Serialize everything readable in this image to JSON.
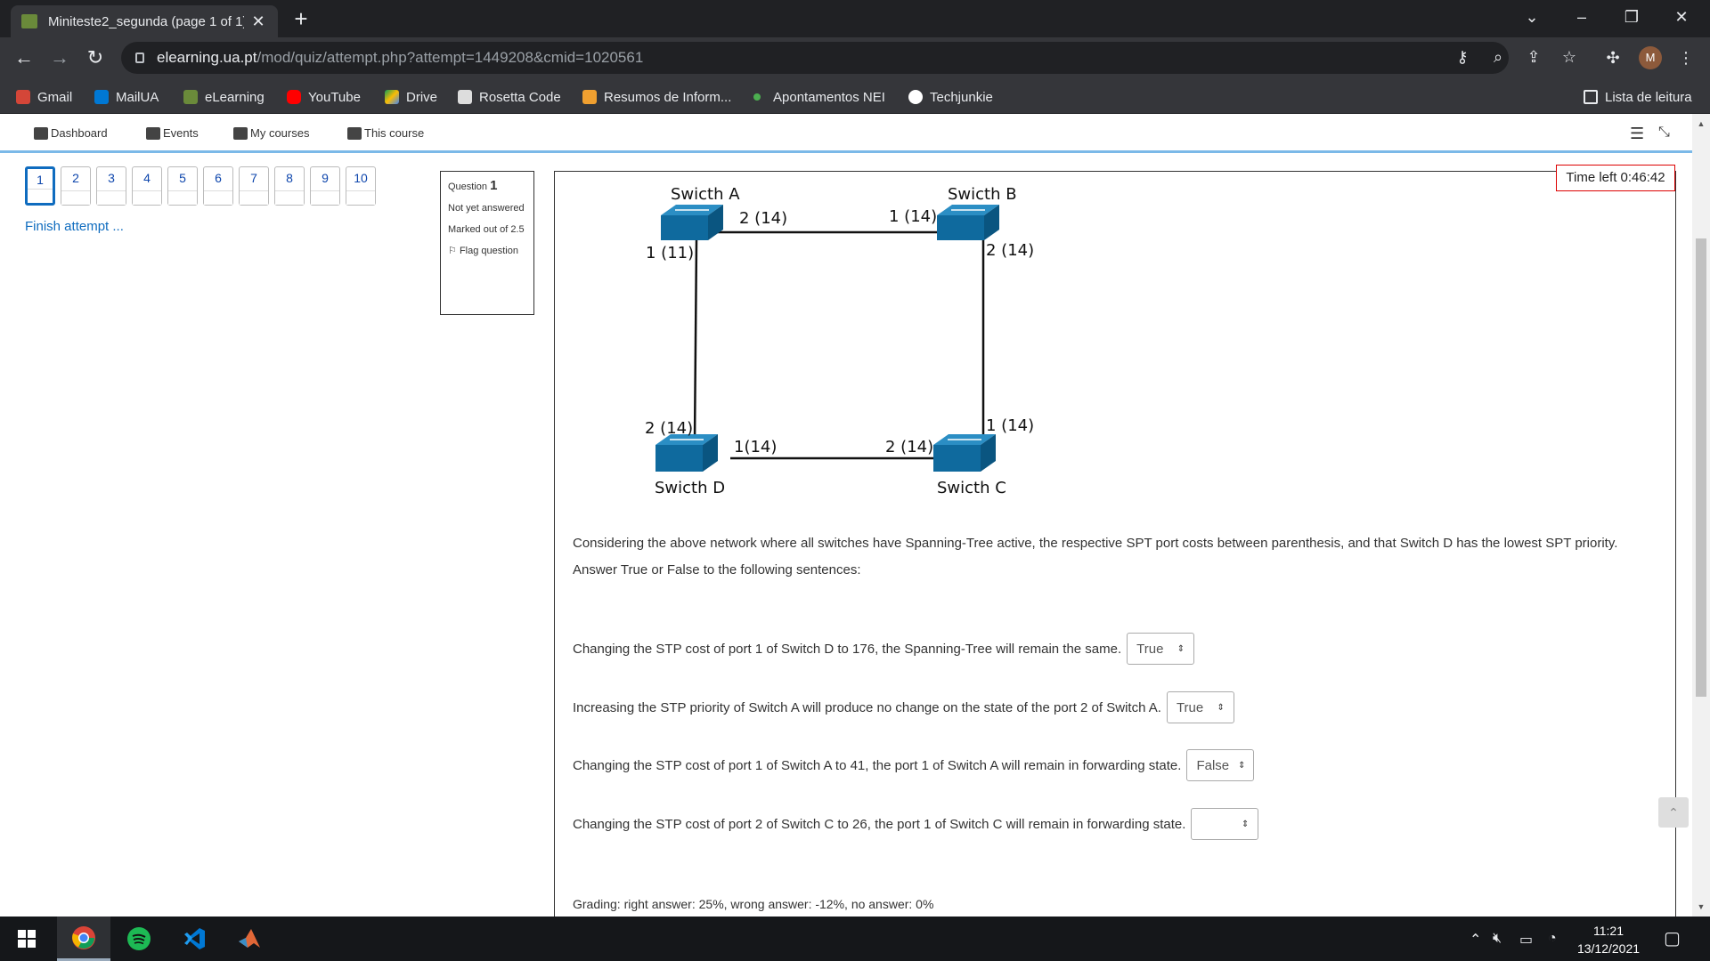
{
  "browser": {
    "tab_title": "Miniteste2_segunda (page 1 of 1)",
    "url_host": "elearning.ua.pt",
    "url_path": "/mod/quiz/attempt.php?attempt=1449208&cmid=1020561",
    "profile_initial": "M"
  },
  "bookmarks": [
    {
      "label": "Gmail",
      "icon": "gmail-icon"
    },
    {
      "label": "MailUA",
      "icon": "outlook-icon"
    },
    {
      "label": "eLearning",
      "icon": "elearning-icon"
    },
    {
      "label": "YouTube",
      "icon": "youtube-icon"
    },
    {
      "label": "Drive",
      "icon": "drive-icon"
    },
    {
      "label": "Rosetta Code",
      "icon": "rosetta-icon"
    },
    {
      "label": "Resumos de Inform...",
      "icon": "box-icon"
    },
    {
      "label": "Apontamentos NEI",
      "icon": "dot-icon"
    },
    {
      "label": "Techjunkie",
      "icon": "globe-icon"
    },
    {
      "label": "Lista de leitura",
      "icon": "reading-list-icon"
    }
  ],
  "moodle_nav": [
    {
      "label": "Dashboard",
      "icon": "dashboard-icon"
    },
    {
      "label": "Events",
      "icon": "calendar-icon"
    },
    {
      "label": "My courses",
      "icon": "briefcase-icon"
    },
    {
      "label": "This course",
      "icon": "sitemap-icon"
    }
  ],
  "quiz_nav": {
    "questions": [
      "1",
      "2",
      "3",
      "4",
      "5",
      "6",
      "7",
      "8",
      "9",
      "10"
    ],
    "current": "1",
    "finish_label": "Finish attempt ..."
  },
  "question_info": {
    "label": "Question",
    "number": "1",
    "status": "Not yet answered",
    "marks": "Marked out of 2.5",
    "flag": "Flag question"
  },
  "timer": "Time left 0:46:42",
  "diagram": {
    "switches": [
      "Swicth A",
      "Swicth B",
      "Swicth D",
      "Swicth C"
    ],
    "port_labels": {
      "a_right": "2 (14)",
      "a_down": "1 (11)",
      "b_left": "1 (14)",
      "b_down": "2 (14)",
      "d_up": "2 (14)",
      "d_right": "1(14)",
      "c_left": "2 (14)",
      "c_up": "1 (14)"
    }
  },
  "question_text": "Considering the above network where all switches have Spanning-Tree active, the respective SPT port costs between parenthesis, and that Switch D has the lowest SPT priority. Answer True or False to the following sentences:",
  "sentences": [
    {
      "text": "Changing the STP cost of port 1 of Switch D to 176, the Spanning-Tree will remain the same.",
      "value": "True"
    },
    {
      "text": "Increasing the STP priority of Switch A will produce no change on the state of the port 2 of Switch A.",
      "value": "True"
    },
    {
      "text": "Changing the STP cost of port 1 of Switch A to 41, the port 1 of Switch A will remain in forwarding state.",
      "value": "False"
    },
    {
      "text": "Changing the STP cost of port 2 of Switch C to 26, the port 1 of Switch C will remain in forwarding state.",
      "value": ""
    }
  ],
  "grading": "Grading: right answer: 25%, wrong answer: -12%, no answer: 0%",
  "taskbar": {
    "time": "11:21",
    "date": "13/12/2021"
  },
  "colors": {
    "switch_blue": "#0f6a9e",
    "link_blue": "#0f6cbf",
    "timer_border": "#dd0000"
  }
}
